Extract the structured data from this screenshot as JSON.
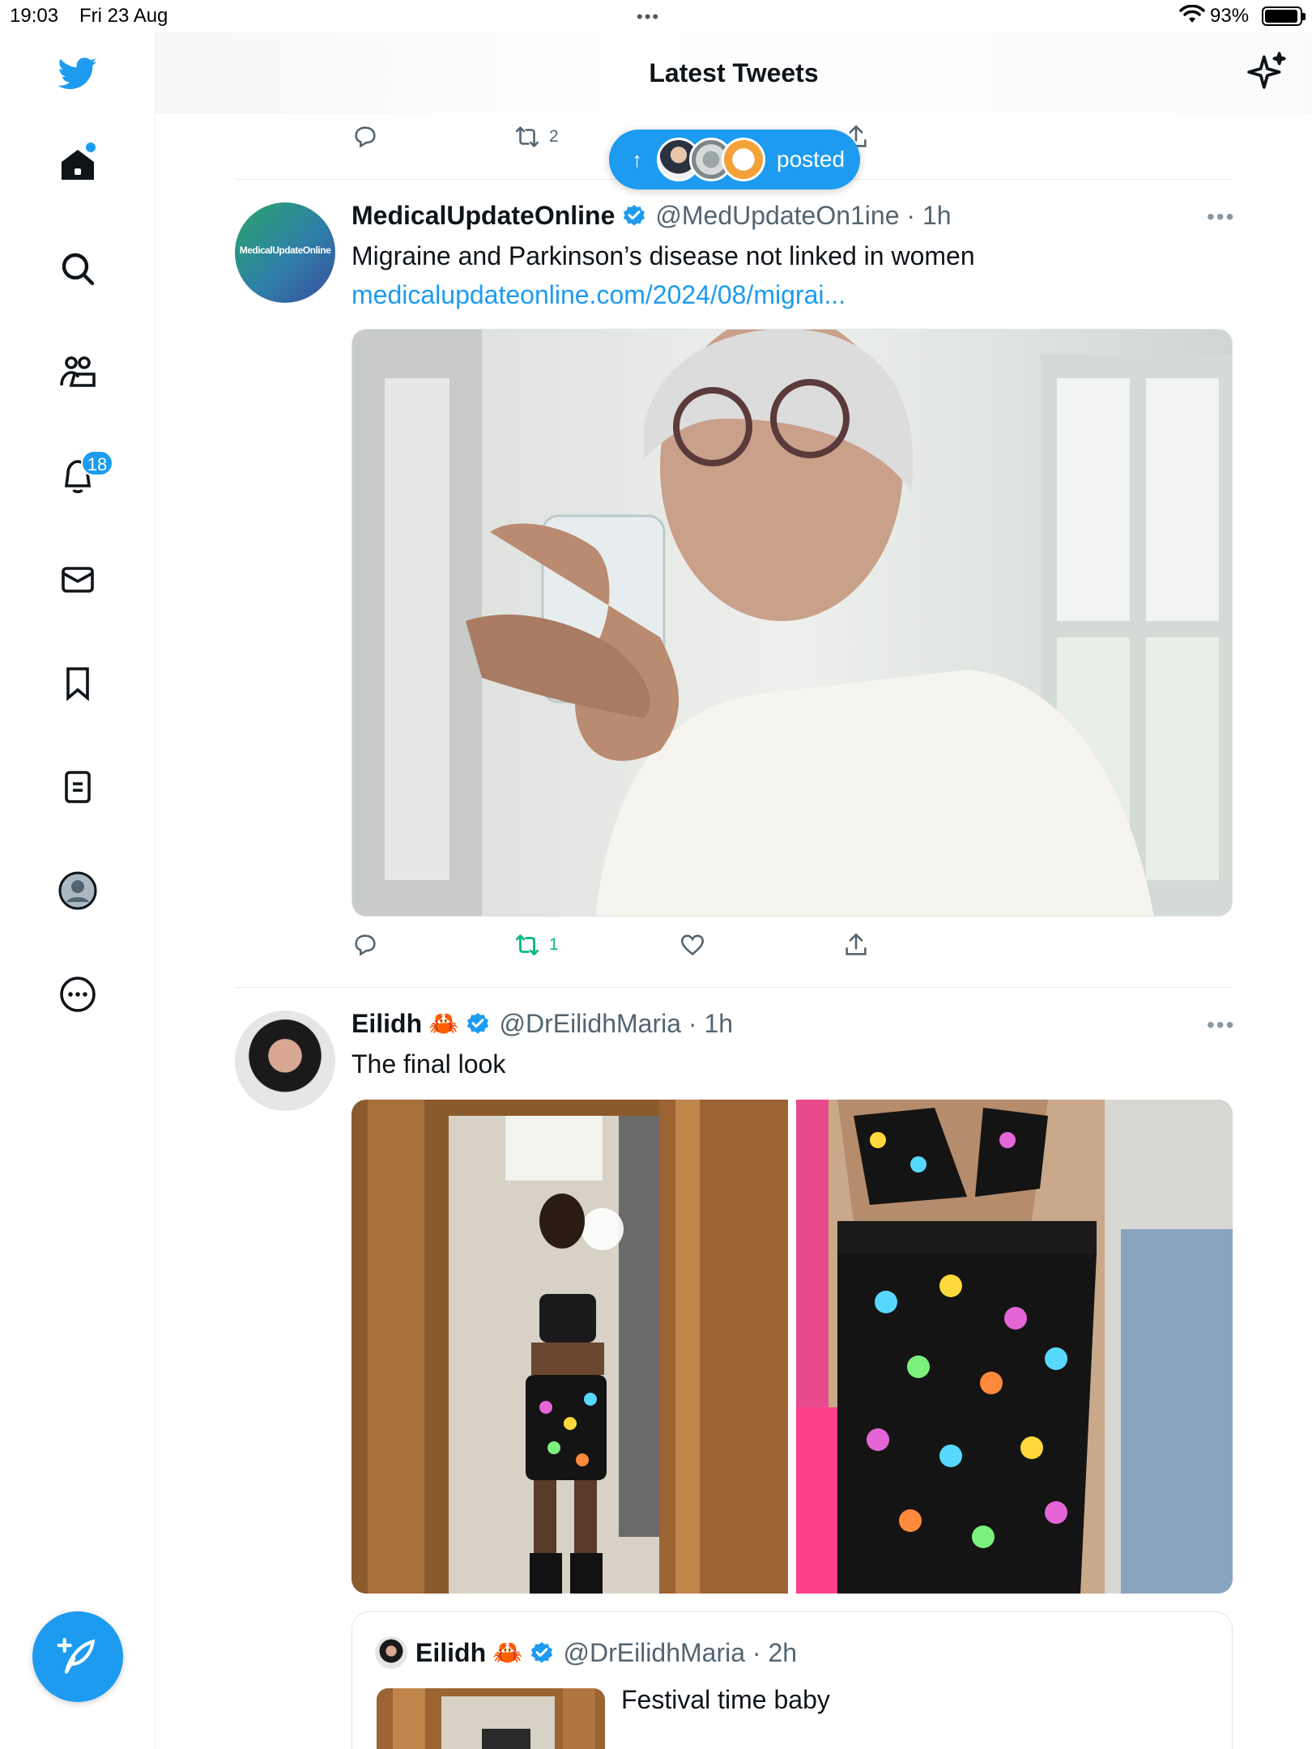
{
  "status_bar": {
    "time": "19:03",
    "date": "Fri 23 Aug",
    "dots": "•••",
    "battery": "93%"
  },
  "sidebar": {
    "notifications_badge": "18"
  },
  "header": {
    "title": "Latest Tweets"
  },
  "top_actions": {
    "retweet_count": "2"
  },
  "posted_pill": {
    "label": "posted"
  },
  "tweets": [
    {
      "name": "MedicalUpdateOnline",
      "handle": "@MedUpdateOn1ine · 1h",
      "avatar_text": "MedicalUpdateOnline",
      "text": "Migraine and Parkinson’s disease not linked in women",
      "link": "medicalupdateonline.com/2024/08/migrai...",
      "retweet_count": "1"
    },
    {
      "name": "Eilidh",
      "emoji": "🦀",
      "handle": "@DrEilidhMaria · 1h",
      "text": "The final look"
    }
  ],
  "quoted_tweet": {
    "name": "Eilidh",
    "emoji": "🦀",
    "handle": "@DrEilidhMaria · 2h",
    "text": "Festival time baby"
  },
  "colors": {
    "accent": "#1d9bf0",
    "retweet_green": "#00ba7c",
    "text_secondary": "#536471"
  }
}
